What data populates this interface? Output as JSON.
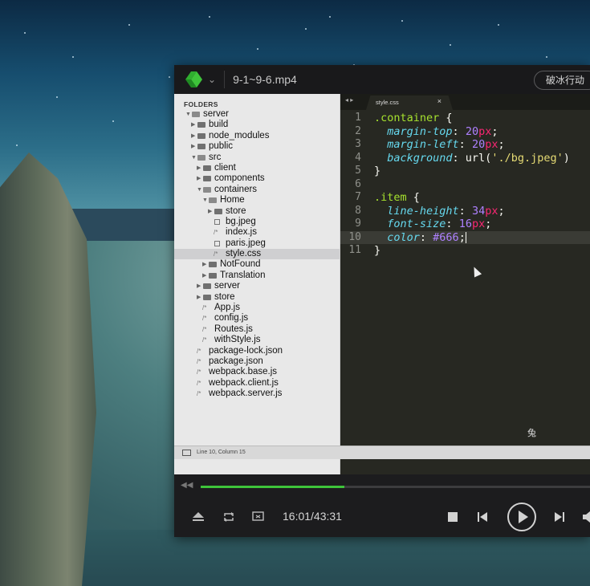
{
  "window": {
    "title": "9-1~9-6.mp4",
    "action_button": "破冰行动"
  },
  "sidebar": {
    "header": "FOLDERS",
    "tree": [
      {
        "label": "server",
        "depth": 0,
        "kind": "folder-open",
        "expanded": true
      },
      {
        "label": "build",
        "depth": 1,
        "kind": "folder"
      },
      {
        "label": "node_modules",
        "depth": 1,
        "kind": "folder"
      },
      {
        "label": "public",
        "depth": 1,
        "kind": "folder"
      },
      {
        "label": "src",
        "depth": 1,
        "kind": "folder-open",
        "expanded": true
      },
      {
        "label": "client",
        "depth": 2,
        "kind": "folder"
      },
      {
        "label": "components",
        "depth": 2,
        "kind": "folder"
      },
      {
        "label": "containers",
        "depth": 2,
        "kind": "folder-open",
        "expanded": true
      },
      {
        "label": "Home",
        "depth": 3,
        "kind": "folder-open",
        "expanded": true
      },
      {
        "label": "store",
        "depth": 4,
        "kind": "folder"
      },
      {
        "label": "bg.jpeg",
        "depth": 4,
        "kind": "image"
      },
      {
        "label": "index.js",
        "depth": 4,
        "kind": "file"
      },
      {
        "label": "paris.jpeg",
        "depth": 4,
        "kind": "image"
      },
      {
        "label": "style.css",
        "depth": 4,
        "kind": "file",
        "selected": true
      },
      {
        "label": "NotFound",
        "depth": 3,
        "kind": "folder"
      },
      {
        "label": "Translation",
        "depth": 3,
        "kind": "folder"
      },
      {
        "label": "server",
        "depth": 2,
        "kind": "folder"
      },
      {
        "label": "store",
        "depth": 2,
        "kind": "folder"
      },
      {
        "label": "App.js",
        "depth": 2,
        "kind": "file"
      },
      {
        "label": "config.js",
        "depth": 2,
        "kind": "file"
      },
      {
        "label": "Routes.js",
        "depth": 2,
        "kind": "file"
      },
      {
        "label": "withStyle.js",
        "depth": 2,
        "kind": "file"
      },
      {
        "label": "package-lock.json",
        "depth": 1,
        "kind": "file"
      },
      {
        "label": "package.json",
        "depth": 1,
        "kind": "file"
      },
      {
        "label": "webpack.base.js",
        "depth": 1,
        "kind": "file"
      },
      {
        "label": "webpack.client.js",
        "depth": 1,
        "kind": "file"
      },
      {
        "label": "webpack.server.js",
        "depth": 1,
        "kind": "file"
      }
    ]
  },
  "editor": {
    "tab_nav": "◂ ▸",
    "tab": "style.css",
    "tab_close": "×",
    "lines": [
      [
        [
          "sel",
          ".container"
        ],
        [
          "plain",
          " {"
        ]
      ],
      [
        [
          "plain",
          "  "
        ],
        [
          "prop",
          "margin-top"
        ],
        [
          "plain",
          ": "
        ],
        [
          "num",
          "20"
        ],
        [
          "unit",
          "px"
        ],
        [
          "plain",
          ";"
        ]
      ],
      [
        [
          "plain",
          "  "
        ],
        [
          "prop",
          "margin-left"
        ],
        [
          "plain",
          ": "
        ],
        [
          "num",
          "20"
        ],
        [
          "unit",
          "px"
        ],
        [
          "plain",
          ";"
        ]
      ],
      [
        [
          "plain",
          "  "
        ],
        [
          "prop",
          "background"
        ],
        [
          "plain",
          ": url("
        ],
        [
          "str",
          "'./bg.jpeg'"
        ],
        [
          "plain",
          ")"
        ]
      ],
      [
        [
          "plain",
          "}"
        ]
      ],
      [
        [
          "plain",
          ""
        ]
      ],
      [
        [
          "sel",
          ".item"
        ],
        [
          "plain",
          " {"
        ]
      ],
      [
        [
          "plain",
          "  "
        ],
        [
          "prop",
          "line-height"
        ],
        [
          "plain",
          ": "
        ],
        [
          "num",
          "34"
        ],
        [
          "unit",
          "px"
        ],
        [
          "plain",
          ";"
        ]
      ],
      [
        [
          "plain",
          "  "
        ],
        [
          "prop",
          "font-size"
        ],
        [
          "plain",
          ": "
        ],
        [
          "num",
          "16"
        ],
        [
          "unit",
          "px"
        ],
        [
          "plain",
          ";"
        ]
      ],
      [
        [
          "plain",
          "  "
        ],
        [
          "prop",
          "color"
        ],
        [
          "plain",
          ": "
        ],
        [
          "num",
          "#666"
        ],
        [
          "plain",
          ";"
        ],
        [
          "caret",
          ""
        ]
      ],
      [
        [
          "plain",
          "}"
        ]
      ]
    ],
    "current_line": 10,
    "watermark": "兔",
    "status": "Line 10, Column 15"
  },
  "player": {
    "progress": 0.3698,
    "time": "16:01/43:31",
    "icons": [
      "eject-icon",
      "repeat-icon",
      "screen-icon",
      "stop-icon",
      "previous-icon",
      "play-icon",
      "next-icon"
    ]
  },
  "colors": {
    "progress": "#3ec43a",
    "logo": "#2fae2f"
  }
}
